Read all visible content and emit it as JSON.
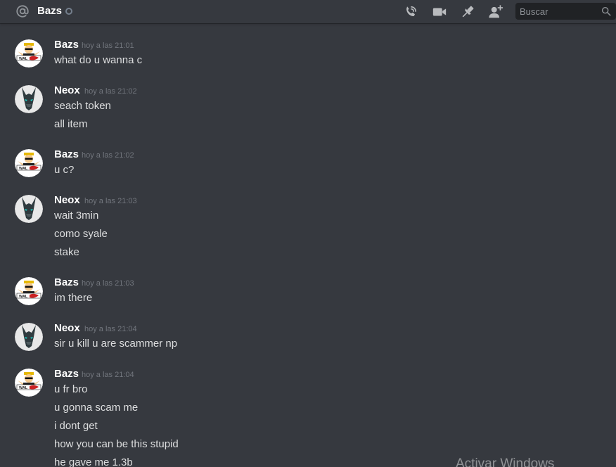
{
  "header": {
    "dm_name": "Bazs",
    "icons": [
      "at-icon",
      "phone-call-icon",
      "video-call-icon",
      "pin-icon",
      "add-friend-icon",
      "search-icon"
    ],
    "search_placeholder": "Buscar"
  },
  "colors": {
    "background": "#36393f",
    "username": "#ffffff",
    "message_text": "#dcddde",
    "timestamp": "#72767d",
    "search_bg": "#202225"
  },
  "messages": [
    {
      "author": "Bazs",
      "time": "hoy a las 21:01",
      "lines": [
        "what do u wanna c"
      ]
    },
    {
      "author": "Neox",
      "time": "hoy a las 21:02",
      "lines": [
        "seach token",
        "all item"
      ]
    },
    {
      "author": "Bazs",
      "time": "hoy a las 21:02",
      "lines": [
        "u c?"
      ]
    },
    {
      "author": "Neox",
      "time": "hoy a las 21:03",
      "lines": [
        "wait 3min",
        "como syale",
        "stake"
      ]
    },
    {
      "author": "Bazs",
      "time": "hoy a las 21:03",
      "lines": [
        "im there"
      ]
    },
    {
      "author": "Neox",
      "time": "hoy a las 21:04",
      "lines": [
        "sir u kill u are scammer np"
      ]
    },
    {
      "author": "Bazs",
      "time": "hoy a las 21:04",
      "lines": [
        "u fr bro",
        "u gonna scam me",
        "i dont get",
        "how you can be this stupid",
        "he gave me 1.3b"
      ]
    }
  ],
  "watermark": "Activar Windows"
}
